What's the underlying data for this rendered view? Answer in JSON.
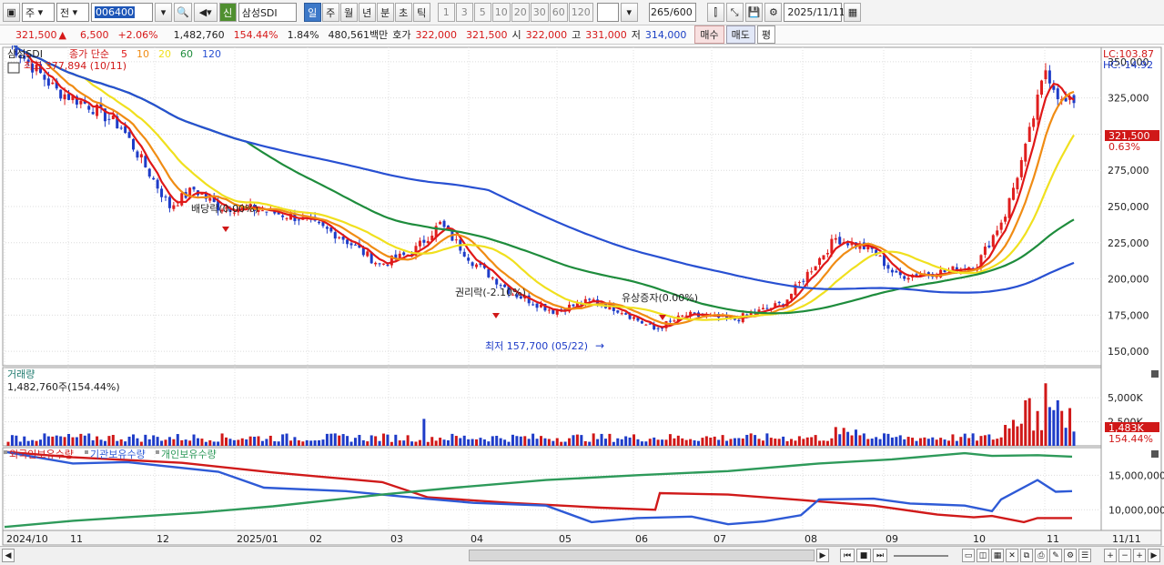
{
  "toolbar": {
    "market_select": "주",
    "prev_label": "전",
    "code": "006400",
    "name_badge": "신",
    "name": "삼성SDI",
    "period_tabs": [
      "일",
      "주",
      "월",
      "년",
      "분",
      "초",
      "틱"
    ],
    "period_active": "일",
    "minute_buttons": [
      "1",
      "3",
      "5",
      "10",
      "20",
      "30",
      "60",
      "120"
    ],
    "count": "265",
    "count_total": "/600",
    "date": "2025/11/11"
  },
  "quote": {
    "price": "321,500",
    "arrow": "▲",
    "change": "6,500",
    "change_pct": "+2.06%",
    "volume": "1,482,760",
    "volume_pct": "154.44%",
    "turnover": "1.84%",
    "amount": "480,561백만",
    "hoga_label": "호가",
    "bid": "322,000",
    "ask": "321,500",
    "open_label": "시",
    "open": "322,000",
    "high_label": "고",
    "high": "331,000",
    "low_label": "저",
    "low": "314,000",
    "buy_label": "매수",
    "sell_label": "매도",
    "p_label": "평"
  },
  "chart": {
    "price_title": "삼성SDI",
    "legend_close": "종가 단순",
    "ma_labels": [
      "5",
      "10",
      "20",
      "60",
      "120"
    ],
    "ma_colors": [
      "#e01818",
      "#f08c14",
      "#f0e01e",
      "#1e8c3c",
      "#2850d2"
    ],
    "high_note": "최고 377,894 (10/11)",
    "low_note": "최저 157,700 (05/22)",
    "events": [
      "배당락(0.00%)",
      "권리락(-2.10%)",
      "유상증자(0.00%)"
    ],
    "lc_label": "LC:103.87",
    "hc_label": "HC:-14.92",
    "price_box": "321,500",
    "pct_box": "0.63%",
    "price_axis": [
      "350,000",
      "325,000",
      "300,000",
      "275,000",
      "250,000",
      "225,000",
      "200,000",
      "175,000",
      "150,000"
    ],
    "volume_title": "거래량",
    "volume_value": "1,482,760주(154.44%)",
    "volume_axis": [
      "5,000K",
      "2,500K"
    ],
    "volume_box": "1,483K",
    "volume_pct_box": "154.44%",
    "holding_legend": [
      "외국인보유수량",
      "기관보유수량",
      "개인보유수량"
    ],
    "holding_colors": [
      "#d01a1a",
      "#2e5ad6",
      "#2e9a5a"
    ],
    "holding_axis": [
      "15,000,000",
      "10,000,000"
    ],
    "x_labels": [
      "2024/10",
      "11",
      "12",
      "2025/01",
      "02",
      "03",
      "04",
      "05",
      "06",
      "07",
      "08",
      "09",
      "10",
      "11"
    ],
    "x_end_label": "11/11"
  }
}
